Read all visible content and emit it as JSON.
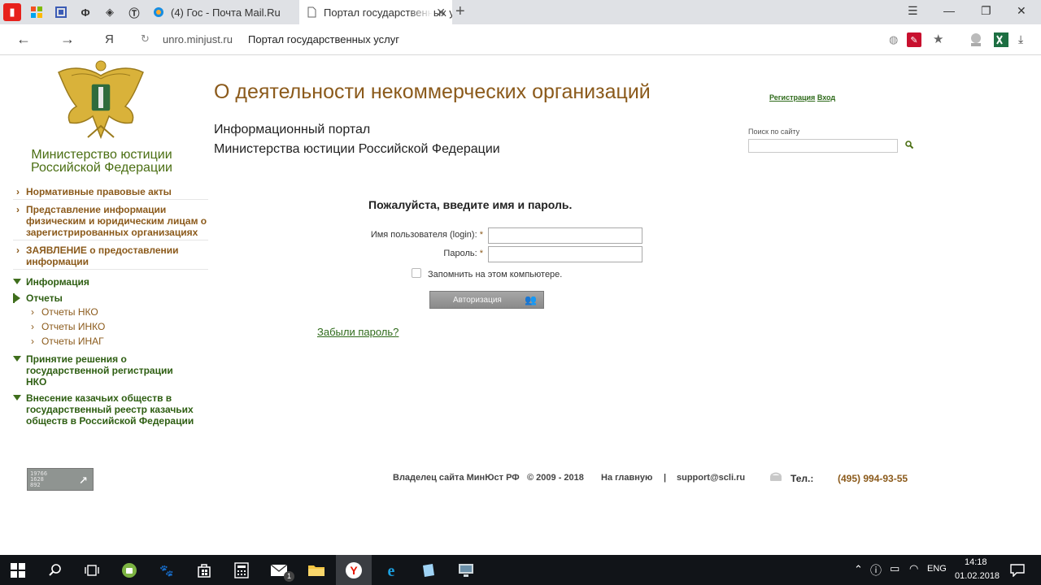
{
  "browser": {
    "tabs": [
      {
        "label": "(4) Гос - Почта Mail.Ru",
        "active": false
      },
      {
        "label": "Портал государственных услуг",
        "active": true
      }
    ],
    "address": {
      "domain": "unro.minjust.ru",
      "page_title": "Портал государственных услуг"
    },
    "nav_letter": "Я"
  },
  "page": {
    "ministry_name_line1": "Министерство юстиции",
    "ministry_name_line2": "Российской Федерации",
    "main_title": "О деятельности некоммерческих организаций",
    "portal_line1": "Информационный портал",
    "portal_line2": "Министерства юстиции Российской Федерации",
    "header_links": {
      "register": "Регистрация",
      "login": "Вход"
    },
    "search": {
      "label": "Поиск по сайту",
      "value": ""
    },
    "nav": {
      "brown_items": [
        "Нормативные правовые акты",
        "Представление информации физическим и юридическим лицам о зарегистрированных организациях",
        "ЗАЯВЛЕНИЕ о предоставлении информации"
      ],
      "info": "Информация",
      "reports": "Отчеты",
      "report_items": [
        "Отчеты НКО",
        "Отчеты ИНКО",
        "Отчеты ИНАГ"
      ],
      "decision": "Принятие решения о государственной регистрации НКО",
      "cossack": "Внесение казачьих обществ в государственный реестр казачьих обществ в Российской Федерации"
    },
    "counter": {
      "line1": "19766",
      "line2": "1628",
      "line3": "892"
    },
    "login_form": {
      "title": "Пожалуйста, введите имя и пароль.",
      "username_label": "Имя пользователя (login):",
      "password_label": "Пароль:",
      "required_mark": "*",
      "remember_label": "Запомнить на этом компьютере.",
      "submit": "Авторизация",
      "forgot": "Забыли пароль?"
    },
    "footer": {
      "owner": "Владелец сайта МинЮст РФ",
      "copyright": "© 2009 - 2018",
      "home": "На главную",
      "separator": "|",
      "email": "support@scli.ru",
      "phone_label": "Тел.:",
      "phone": "(495) 994-93-55"
    }
  },
  "taskbar": {
    "language": "ENG",
    "time": "14:18",
    "date": "01.02.2018",
    "mail_badge": "1"
  },
  "colors": {
    "title_brown": "#8b5a1b",
    "nav_green": "#2e5e12",
    "link_green": "#2e6a1a",
    "ministry_green": "#4a6e12"
  }
}
